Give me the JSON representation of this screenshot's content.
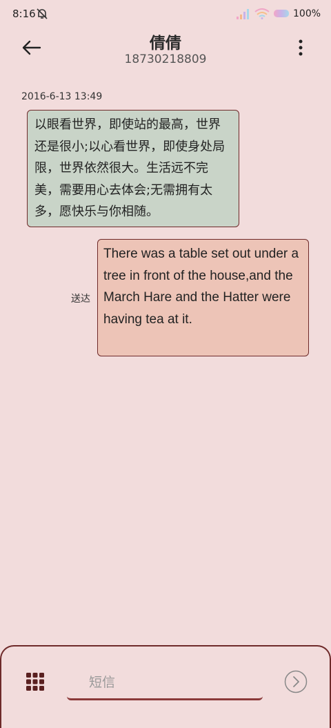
{
  "status_bar": {
    "time": "8:16",
    "battery": "100%"
  },
  "header": {
    "title": "倩倩",
    "subtitle": "18730218809"
  },
  "conversation": {
    "timestamp": "2016-6-13 13:49",
    "incoming_text": "以眼看世界，即使站的最高，世界还是很小;以心看世界，即使身处局限，世界依然很大。生活远不完美，需要用心去体会;无需拥有太多，愿快乐与你相随。",
    "outgoing_text": "There was a table set out under a tree in front of the house,and the March Hare and the Hatter were having tea at it.",
    "outgoing_status": "送达"
  },
  "compose": {
    "placeholder": "短信"
  },
  "colors": {
    "background": "#f2dcdc",
    "incoming_bubble": "#c9d4c8",
    "outgoing_bubble": "#edc4b7",
    "accent": "#8b3a3a"
  },
  "icons": [
    "bell-muted-icon",
    "signal-icon",
    "wifi-icon",
    "battery-icon",
    "back-arrow-icon",
    "more-vert-icon",
    "grid-icon",
    "send-icon"
  ]
}
